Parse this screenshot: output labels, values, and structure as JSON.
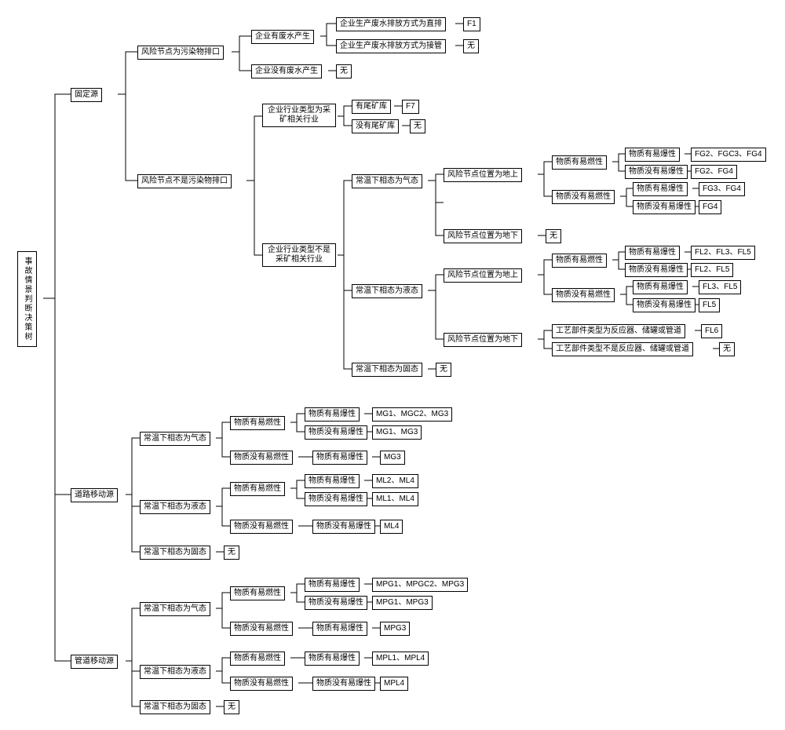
{
  "root": "事故情景判断决策树",
  "L1": {
    "fixed": "固定源",
    "road": "道路移动源",
    "pipe": "管道移动源"
  },
  "fixed": {
    "n1": "风险节点为污染物排口",
    "n2": "风险节点不是污染物排口",
    "ww_yes": "企业有废水产生",
    "ww_no": "企业没有废水产生",
    "none": "无",
    "direct": "企业生产废水排放方式为直排",
    "conn": "企业生产废水排放方式为接管",
    "F1": "F1",
    "mining": "企业行业类型为采矿相关行业",
    "notmining": "企业行业类型不是采矿相关行业",
    "tail_yes": "有尾矿库",
    "tail_no": "没有尾矿库",
    "F7": "F7",
    "gas": "常温下相态为气态",
    "liq": "常温下相态为液态",
    "sol": "常温下相态为固态",
    "pos_up": "风险节点位置为地上",
    "pos_down": "风险节点位置为地下",
    "flam_yes": "物质有易燃性",
    "flam_no": "物质没有易燃性",
    "exp_yes": "物质有易爆性",
    "exp_no": "物质没有易爆性",
    "FG1": "FG2、FGC3、FG4",
    "FG2": "FG2、FG4",
    "FG3": "FG3、FG4",
    "FG4": "FG4",
    "FL1": "FL2、FL3、FL5",
    "FL2": "FL2、FL5",
    "FL3": "FL3、FL5",
    "FL4": "FL5",
    "proc_yes": "工艺部件类型为反应器、储罐或管道",
    "proc_no": "工艺部件类型不是反应器、储罐或管道",
    "FL6": "FL6"
  },
  "road": {
    "gas": "常温下相态为气态",
    "liq": "常温下相态为液态",
    "sol": "常温下相态为固态",
    "none": "无",
    "flam_yes": "物质有易燃性",
    "flam_no": "物质没有易燃性",
    "exp_yes": "物质有易爆性",
    "exp_no": "物质没有易爆性",
    "MG1": "MG1、MGC2、MG3",
    "MG2": "MG1、MG3",
    "MG3": "MG3",
    "ML1": "ML2、ML4",
    "ML2": "ML1、ML4",
    "ML3": "ML4"
  },
  "pipe": {
    "gas": "常温下相态为气态",
    "liq": "常温下相态为液态",
    "sol": "常温下相态为固态",
    "none": "无",
    "flam_yes": "物质有易燃性",
    "flam_no": "物质没有易燃性",
    "exp_yes": "物质有易爆性",
    "exp_no": "物质没有易爆性",
    "MPG1": "MPG1、MPGC2、MPG3",
    "MPG2": "MPG1、MPG3",
    "MPG3": "MPG3",
    "MPL1": "MPL1、MPL4",
    "MPL2": "MPL4"
  }
}
